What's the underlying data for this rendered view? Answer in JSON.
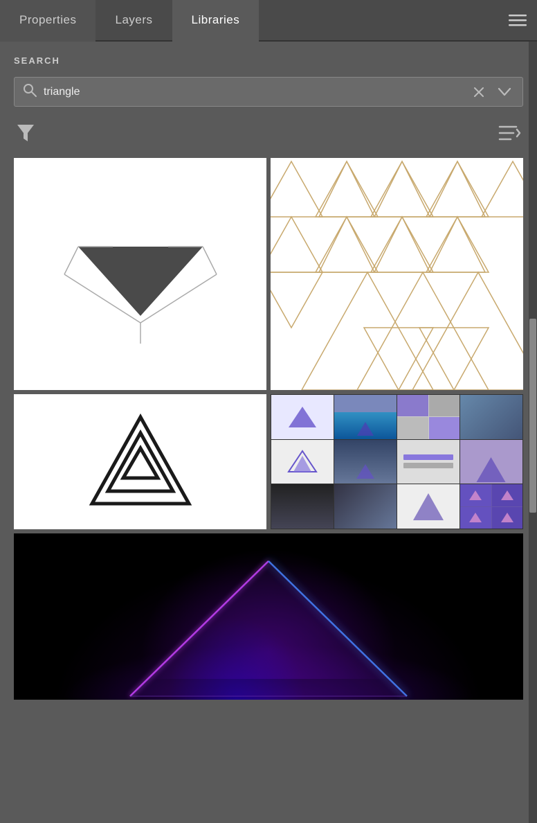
{
  "tabs": [
    {
      "label": "Properties",
      "active": false
    },
    {
      "label": "Layers",
      "active": false
    },
    {
      "label": "Libraries",
      "active": true
    }
  ],
  "menu_icon": "≡",
  "search": {
    "section_label": "SEARCH",
    "placeholder": "triangle",
    "value": "triangle",
    "clear_button": "×",
    "expand_button": "⌄"
  },
  "filter": {
    "filter_label": "Filter",
    "sort_label": "Sort"
  },
  "results": [
    {
      "id": "result-1",
      "type": "dark-triangle",
      "description": "Dark geometric triangle logo on white"
    },
    {
      "id": "result-2",
      "type": "gold-triangles",
      "description": "Gold outlined triangles pattern on white"
    },
    {
      "id": "result-3",
      "type": "triple-triangle",
      "description": "Triple outline triangle logo on white"
    },
    {
      "id": "result-4",
      "type": "presentation-mosaic",
      "description": "Triangle presentation template mosaic"
    },
    {
      "id": "result-5",
      "type": "neon-triangle",
      "description": "Neon purple triangle on dark background"
    }
  ],
  "colors": {
    "background": "#4a4a4a",
    "panel": "#5a5a5a",
    "active_tab": "#5a5a5a",
    "border": "#888",
    "text_primary": "#ffffff",
    "text_secondary": "#cccccc",
    "gold": "#c8a96e",
    "dark_triangle": "#4a4a4a"
  }
}
